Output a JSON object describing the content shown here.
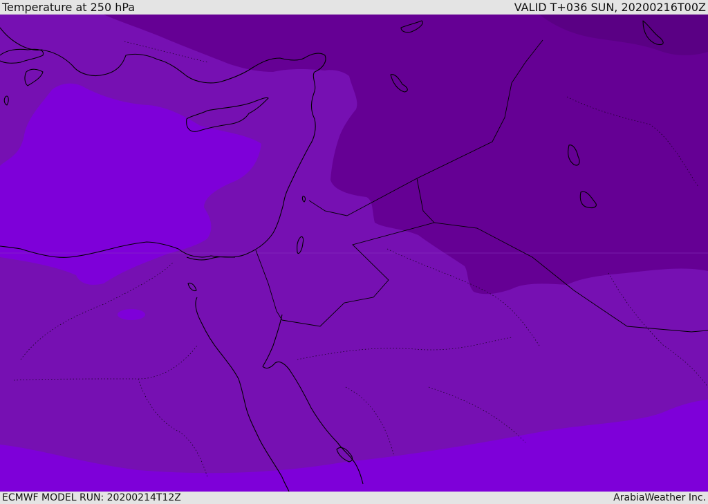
{
  "header": {
    "title": "Temperature at 250 hPa",
    "valid_time": "VALID T+036 SUN, 20200216T00Z"
  },
  "footer": {
    "model_run": "ECMWF MODEL RUN: 20200214T12Z",
    "credit": "ArabiaWeather Inc."
  },
  "map": {
    "field": "Temperature at 250 hPa",
    "colors": {
      "band_mid": "#7610b2",
      "band_warm": "#7e00d9",
      "band_cold": "#650094",
      "band_coldest": "#5a0084",
      "coastline": "#000000",
      "border": "#000000"
    }
  }
}
